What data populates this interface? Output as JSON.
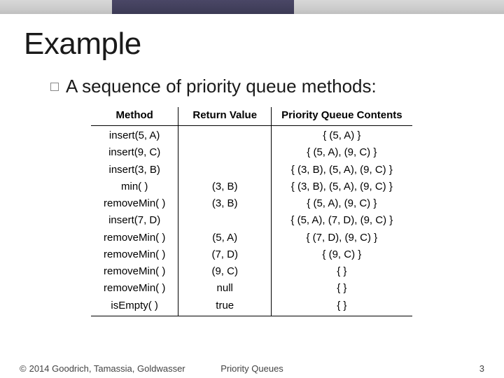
{
  "title": "Example",
  "bullet": "A sequence of priority queue methods:",
  "table": {
    "headers": [
      "Method",
      "Return Value",
      "Priority Queue Contents"
    ],
    "rows": [
      {
        "method": "insert(5, A)",
        "ret": "",
        "contents": "{ (5, A) }"
      },
      {
        "method": "insert(9, C)",
        "ret": "",
        "contents": "{ (5, A), (9, C) }"
      },
      {
        "method": "insert(3, B)",
        "ret": "",
        "contents": "{ (3, B), (5, A), (9, C) }"
      },
      {
        "method": "min( )",
        "ret": "(3, B)",
        "contents": "{ (3, B), (5, A), (9, C) }"
      },
      {
        "method": "removeMin( )",
        "ret": "(3, B)",
        "contents": "{ (5, A), (9, C) }"
      },
      {
        "method": "insert(7, D)",
        "ret": "",
        "contents": "{ (5, A), (7, D), (9, C) }"
      },
      {
        "method": "removeMin( )",
        "ret": "(5, A)",
        "contents": "{ (7, D), (9, C) }"
      },
      {
        "method": "removeMin( )",
        "ret": "(7, D)",
        "contents": "{ (9, C) }"
      },
      {
        "method": "removeMin( )",
        "ret": "(9, C)",
        "contents": "{ }"
      },
      {
        "method": "removeMin( )",
        "ret": "null",
        "contents": "{ }"
      },
      {
        "method": "isEmpty( )",
        "ret": "true",
        "contents": "{ }"
      }
    ]
  },
  "footer": {
    "copyright": "2014 Goodrich, Tamassia, Goldwasser",
    "center": "Priority Queues",
    "page": "3"
  }
}
